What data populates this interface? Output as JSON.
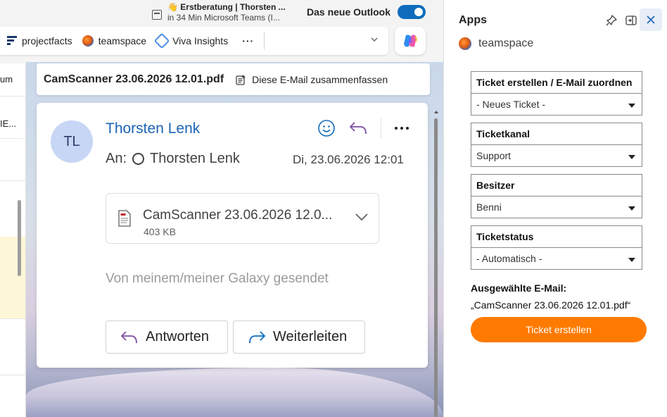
{
  "notification": {
    "line1": "👋 Erstberatung | Thorsten ...",
    "line2": "in 34 Min Microsoft Teams (I..."
  },
  "toggle": {
    "label": "Das neue Outlook",
    "on": true
  },
  "appbar": {
    "items": [
      {
        "label": "projectfacts",
        "icon": "projectfacts-icon"
      },
      {
        "label": "teamspace",
        "icon": "teamspace-icon"
      },
      {
        "label": "Viva Insights",
        "icon": "viva-insights-icon"
      }
    ],
    "more": "···"
  },
  "leftlist": {
    "texts": [
      "um",
      "IE..."
    ]
  },
  "message": {
    "subject": "CamScanner 23.06.2026 12.01.pdf",
    "summarize_label": "Diese E-Mail zusammenfassen",
    "avatar_initials": "TL",
    "sender": "Thorsten Lenk",
    "to_label": "An:",
    "to_name": "Thorsten Lenk",
    "date": "Di, 23.06.2026 12:01",
    "attachment": {
      "name": "CamScanner 23.06.2026 12.0...",
      "size": "403 KB"
    },
    "body": "Von meinem/meiner Galaxy gesendet",
    "reply_label": "Antworten",
    "forward_label": "Weiterleiten"
  },
  "apps_panel": {
    "title": "Apps",
    "brand": "teamspace",
    "fields": [
      {
        "label": "Ticket erstellen / E-Mail zuordnen",
        "value": "- Neues Ticket -"
      },
      {
        "label": "Ticketkanal",
        "value": "Support"
      },
      {
        "label": "Besitzer",
        "value": "Benni"
      },
      {
        "label": "Ticketstatus",
        "value": "- Automatisch -"
      }
    ],
    "selected_email_label": "Ausgewählte E-Mail:",
    "selected_email_value": "„CamScanner 23.06.2026 12.01.pdf“",
    "create_button": "Ticket erstellen"
  },
  "colors": {
    "accent": "#0f6cbd",
    "sender": "#1a64b4",
    "ticket_button": "#ff7a00",
    "reply_icon": "#7b4fa3"
  }
}
